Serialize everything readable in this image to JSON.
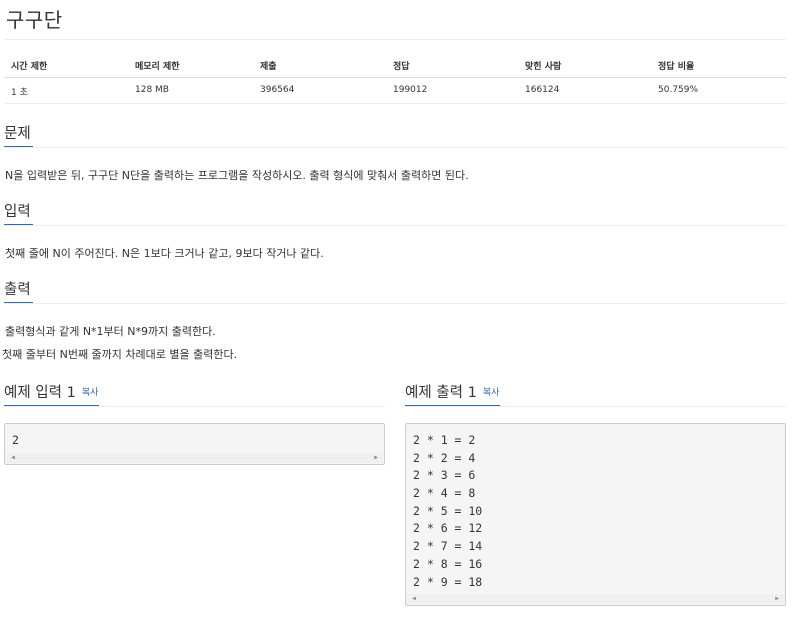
{
  "problem": {
    "title": "구구단"
  },
  "stats": {
    "headers": [
      "시간 제한",
      "메모리 제한",
      "제출",
      "정답",
      "맞힌 사람",
      "정답 비율"
    ],
    "values": [
      "1 초",
      "128 MB",
      "396564",
      "199012",
      "166124",
      "50.759%"
    ]
  },
  "sections": {
    "description": {
      "title": "문제",
      "text": "N을 입력받은 뒤, 구구단 N단을 출력하는 프로그램을 작성하시오. 출력 형식에 맞춰서 출력하면 된다."
    },
    "input": {
      "title": "입력",
      "text": "첫째 줄에 N이 주어진다. N은 1보다 크거나 같고, 9보다 작거나 같다."
    },
    "output": {
      "title": "출력",
      "line1": "출력형식과 같게 N*1부터 N*9까지 출력한다.",
      "line2": "첫째 줄부터 N번째 줄까지 차례대로 별을 출력한다."
    }
  },
  "samples": {
    "input": {
      "title": "예제 입력 1",
      "copy_label": "복사",
      "lines": [
        "2"
      ]
    },
    "output": {
      "title": "예제 출력 1",
      "copy_label": "복사",
      "lines": [
        "2 * 1 = 2",
        "2 * 2 = 4",
        "2 * 3 = 6",
        "2 * 4 = 8",
        "2 * 5 = 10",
        "2 * 6 = 12",
        "2 * 7 = 14",
        "2 * 8 = 16",
        "2 * 9 = 18"
      ]
    }
  },
  "icons": {
    "scroll_left": "scroll-left-arrow-icon",
    "scroll_right": "scroll-right-arrow-icon"
  },
  "colors": {
    "accent": "#2a6db4",
    "code_background": "#f5f5f5"
  }
}
